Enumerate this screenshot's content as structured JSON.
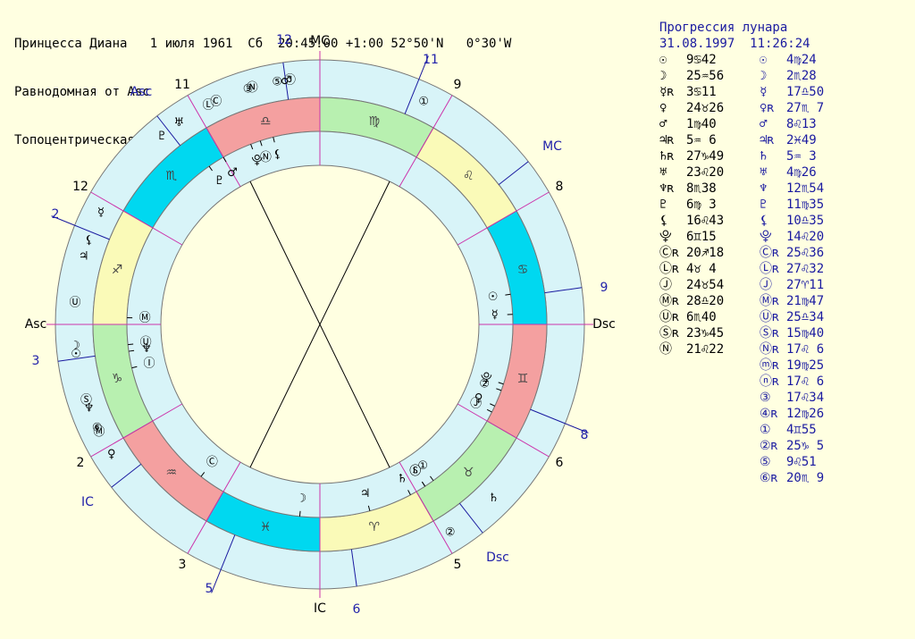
{
  "header": {
    "line1": "Принцесса Диана   1 июля 1961  Сб  20:45:00 +1:00 52°50'N   0°30'W",
    "line2": "Равнодомная от Asc",
    "line3": "Топоцентрическая"
  },
  "progression": {
    "title": "Прогрессия лунара",
    "datetime": "31.08.1997  11:26:24"
  },
  "natal_positions": [
    {
      "sym": "☉",
      "pos": "9♋42"
    },
    {
      "sym": "☽",
      "pos": "25♒56"
    },
    {
      "sym": "☿ʀ",
      "pos": "3♋11"
    },
    {
      "sym": "♀",
      "pos": "24♉26"
    },
    {
      "sym": "♂",
      "pos": "1♍40"
    },
    {
      "sym": "♃ʀ",
      "pos": "5♒ 6"
    },
    {
      "sym": "♄ʀ",
      "pos": "27♑49"
    },
    {
      "sym": "♅",
      "pos": "23♌20"
    },
    {
      "sym": "♆ʀ",
      "pos": "8♏38"
    },
    {
      "sym": "♇",
      "pos": "6♍ 3"
    },
    {
      "sym": "⚸",
      "pos": "16♌43"
    },
    {
      "sym": "⯓",
      "pos": "6♊15"
    },
    {
      "sym": "Ⓒʀ",
      "pos": "20♐18"
    },
    {
      "sym": "Ⓛʀ",
      "pos": "4♉ 4"
    },
    {
      "sym": "Ⓙ",
      "pos": "24♉54"
    },
    {
      "sym": "Ⓜʀ",
      "pos": "28♎20"
    },
    {
      "sym": "Ⓤʀ",
      "pos": "6♏40"
    },
    {
      "sym": "Ⓢʀ",
      "pos": "23♑45"
    },
    {
      "sym": "Ⓝ",
      "pos": "21♌22"
    }
  ],
  "progressed_positions": [
    {
      "sym": "☉",
      "pos": "4♍24"
    },
    {
      "sym": "☽",
      "pos": "2♏28"
    },
    {
      "sym": "☿",
      "pos": "17♎50"
    },
    {
      "sym": "♀ʀ",
      "pos": "27♏ 7"
    },
    {
      "sym": "♂",
      "pos": "8♌13"
    },
    {
      "sym": "♃ʀ",
      "pos": "2♓49"
    },
    {
      "sym": "♄",
      "pos": "5♒ 3"
    },
    {
      "sym": "♅",
      "pos": "4♍26"
    },
    {
      "sym": "♆",
      "pos": "12♏54"
    },
    {
      "sym": "♇",
      "pos": "11♍35"
    },
    {
      "sym": "⚸",
      "pos": "10♎35"
    },
    {
      "sym": "⯓",
      "pos": "14♌20"
    },
    {
      "sym": "Ⓒʀ",
      "pos": "25♌36"
    },
    {
      "sym": "Ⓛʀ",
      "pos": "27♌32"
    },
    {
      "sym": "Ⓙ",
      "pos": "27♈11"
    },
    {
      "sym": "Ⓜʀ",
      "pos": "21♍47"
    },
    {
      "sym": "Ⓤʀ",
      "pos": "25♎34"
    },
    {
      "sym": "Ⓢʀ",
      "pos": "15♍40"
    },
    {
      "sym": "Ⓝʀ",
      "pos": "17♌ 6"
    },
    {
      "sym": "ⓜʀ",
      "pos": "19♍25"
    },
    {
      "sym": "ⓝʀ",
      "pos": "17♌ 6"
    },
    {
      "sym": "③",
      "pos": "17♌34"
    },
    {
      "sym": "④ʀ",
      "pos": "12♍26"
    },
    {
      "sym": "①",
      "pos": "4♊55"
    },
    {
      "sym": "②ʀ",
      "pos": "25♑ 5"
    },
    {
      "sym": "⑤",
      "pos": "9♌51"
    },
    {
      "sym": "⑥ʀ",
      "pos": "20♏ 9"
    }
  ],
  "wheel": {
    "axis_labels": [
      "Asc",
      "Dsc",
      "MC",
      "IC"
    ],
    "outer_axis_labels": [
      "Asc",
      "MC",
      "Dsc",
      "IC"
    ],
    "inner_house_numbers": [
      "11",
      "9",
      "8",
      "6",
      "5",
      "3",
      "2",
      "12"
    ],
    "outer_house_numbers": [
      "12",
      "11",
      "9",
      "8",
      "6",
      "5",
      "3",
      "2"
    ],
    "signs": [
      "♎",
      "♍",
      "♌",
      "♋",
      "♊",
      "♉",
      "♈",
      "♓",
      "♒",
      "♑",
      "♐",
      "♏"
    ],
    "colors": {
      "background": "#ffffe1",
      "ring": "#d8f4f8",
      "fire": "#f4a0a0",
      "earth": "#b8f0b0",
      "air": "#fafab8",
      "water": "#00d8f0",
      "cusp": "#cc33aa",
      "outer_text": "#2222aa"
    },
    "outer_planets": [
      {
        "sym": "☿",
        "lon": 153
      },
      {
        "sym": "⚸",
        "lon": 160
      },
      {
        "sym": "♇",
        "lon": 130
      },
      {
        "sym": "♅",
        "lon": 125
      },
      {
        "sym": "Ⓛ",
        "lon": 117
      },
      {
        "sym": "Ⓒ",
        "lon": 115
      },
      {
        "sym": "③",
        "lon": 107
      },
      {
        "sym": "Ⓝ",
        "lon": 106
      },
      {
        "sym": "⑤",
        "lon": 100
      },
      {
        "sym": "♂",
        "lon": 98
      },
      {
        "sym": "Ⓤ",
        "lon": 175
      },
      {
        "sym": "☽",
        "lon": 185
      },
      {
        "sym": "☉",
        "lon": 187
      },
      {
        "sym": "Ⓢ",
        "lon": 198
      },
      {
        "sym": "♆",
        "lon": 200
      },
      {
        "sym": "⑥",
        "lon": 205
      },
      {
        "sym": "Ⓜ",
        "lon": 206
      },
      {
        "sym": "♀",
        "lon": 212
      },
      {
        "sym": "②",
        "lon": 302
      },
      {
        "sym": "♄",
        "lon": 315
      },
      {
        "sym": "①",
        "lon": 425
      },
      {
        "sym": "Ⓙ",
        "lon": 457
      },
      {
        "sym": "♃",
        "lon": 524
      }
    ],
    "inner_planets": [
      {
        "sym": "Ⓜ",
        "lon": 178
      },
      {
        "sym": "Ⓤ",
        "lon": 186
      },
      {
        "sym": "♆",
        "lon": 188
      },
      {
        "sym": "Ⓘ",
        "lon": 193
      },
      {
        "sym": "♇",
        "lon": 125
      },
      {
        "sym": "♂",
        "lon": 120
      },
      {
        "sym": "⯓",
        "lon": 111
      },
      {
        "sym": "Ⓝ",
        "lon": 108
      },
      {
        "sym": "⚸",
        "lon": 104
      },
      {
        "sym": "Ⓒ",
        "lon": 232
      },
      {
        "sym": "☉",
        "lon": 9
      },
      {
        "sym": "☿",
        "lon": 3
      },
      {
        "sym": "①",
        "lon": 306
      },
      {
        "sym": "Ⓢ",
        "lon": 303
      },
      {
        "sym": "♄",
        "lon": 298
      },
      {
        "sym": "♃",
        "lon": 285
      },
      {
        "sym": "☽",
        "lon": 264
      },
      {
        "sym": "⯓",
        "lon": -18
      },
      {
        "sym": "②",
        "lon": -20
      },
      {
        "sym": "♀",
        "lon": -25
      },
      {
        "sym": "Ⓙ",
        "lon": -27
      },
      {
        "sym": "Ⓛ",
        "lon": -57
      }
    ]
  }
}
